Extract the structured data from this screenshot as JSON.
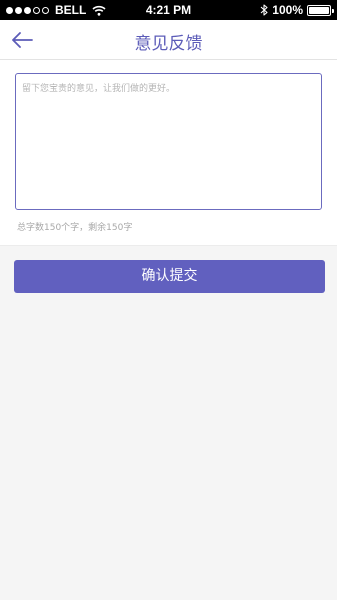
{
  "status_bar": {
    "carrier": "BELL",
    "time": "4:21 PM",
    "battery": "100%",
    "signal_icon": "signal-dots-icon",
    "wifi_icon": "wifi-icon",
    "bluetooth_icon": "bluetooth-icon",
    "battery_icon": "battery-icon"
  },
  "nav": {
    "back_icon": "arrow-left-icon",
    "title": "意见反馈"
  },
  "feedback": {
    "placeholder": "留下您宝贵的意见，让我们做的更好。",
    "value": "",
    "char_count_text": "总字数150个字，剩余150字"
  },
  "submit": {
    "label": "确认提交"
  },
  "colors": {
    "accent": "#6160bf",
    "title": "#5c5cb8",
    "background": "#f5f5f5"
  }
}
